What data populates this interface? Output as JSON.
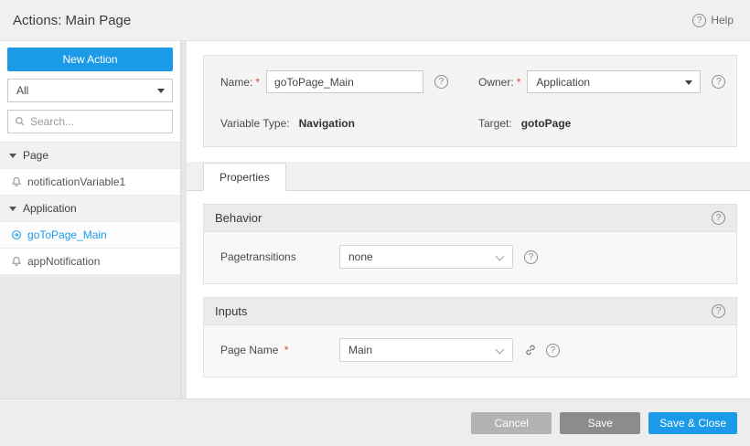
{
  "colors": {
    "accent": "#1b9ae8",
    "required": "#e0472f"
  },
  "icons": {
    "help_glyph": "?",
    "required_marker": "*"
  },
  "header": {
    "title": "Actions: Main Page",
    "help_label": "Help"
  },
  "sidebar": {
    "new_action_label": "New Action",
    "filter_value": "All",
    "search_placeholder": "Search...",
    "tree": [
      {
        "label": "Page"
      },
      {
        "label": "notificationVariable1"
      },
      {
        "label": "Application"
      },
      {
        "label": "goToPage_Main"
      },
      {
        "label": "appNotification"
      }
    ]
  },
  "form": {
    "name_label": "Name:",
    "name_value": "goToPage_Main",
    "owner_label": "Owner:",
    "owner_value": "Application",
    "variable_type_label": "Variable Type:",
    "variable_type_value": "Navigation",
    "target_label": "Target:",
    "target_value": "gotoPage"
  },
  "tabs": {
    "properties_label": "Properties"
  },
  "behavior": {
    "title": "Behavior",
    "pagetransitions_label": "Pagetransitions",
    "pagetransitions_value": "none"
  },
  "inputs": {
    "title": "Inputs",
    "page_name_label": "Page Name",
    "page_name_value": "Main"
  },
  "footer": {
    "cancel_label": "Cancel",
    "save_label": "Save",
    "save_close_label": "Save & Close"
  }
}
